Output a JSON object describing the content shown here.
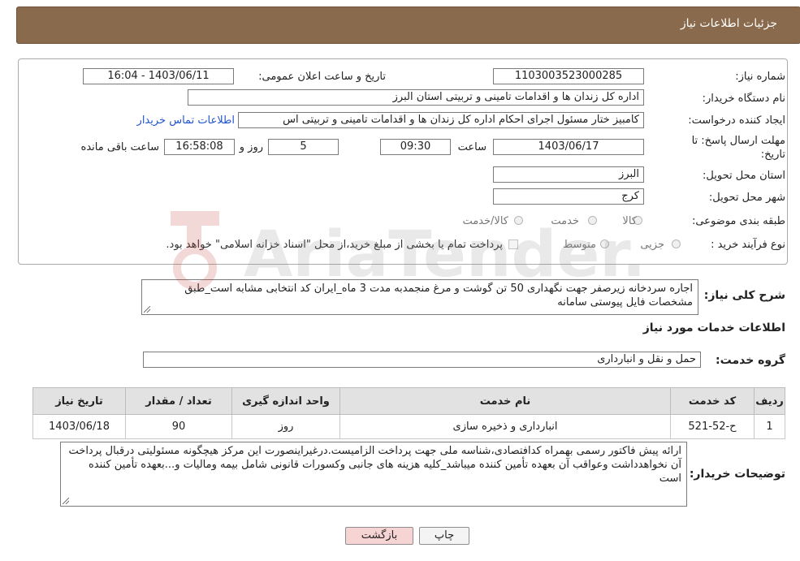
{
  "header": {
    "title": "جزئیات اطلاعات نیاز"
  },
  "form": {
    "need_number_label": "شماره نیاز:",
    "need_number": "1103003523000285",
    "announce_datetime_label": "تاریخ و ساعت اعلان عمومی:",
    "announce_datetime": "1403/06/11 - 16:04",
    "buyer_org_label": "نام دستگاه خریدار:",
    "buyer_org": "اداره کل زندان ها و اقدامات تامینی و تربیتی استان البرز",
    "requester_label": "ایجاد کننده درخواست:",
    "requester": "کامبیز ختار مسئول اجرای احکام اداره کل زندان ها و اقدامات تامینی و تربیتی اس",
    "contact_link": "اطلاعات تماس خریدار",
    "deadline_label_line1": "مهلت ارسال پاسخ: تا",
    "deadline_label_line2": "تاریخ:",
    "deadline_date": "1403/06/17",
    "time_label": "ساعت",
    "deadline_time": "09:30",
    "days_value": "5",
    "days_label": "روز و",
    "remaining_time": "16:58:08",
    "remaining_label": "ساعت باقی مانده",
    "province_label": "استان محل تحویل:",
    "province": "البرز",
    "city_label": "شهر محل تحویل:",
    "city": "کرج",
    "category_label": "طبقه بندی موضوعی:",
    "category_options": [
      "کالا",
      "خدمت",
      "کالا/خدمت"
    ],
    "purchase_type_label": "نوع فرآیند خرید :",
    "purchase_type_options": [
      "جزیی",
      "متوسط"
    ],
    "payment_note": "پرداخت تمام یا بخشی از مبلغ خرید،از محل \"اسناد خزانه اسلامی\" خواهد بود."
  },
  "description": {
    "label": "شرح کلی نیاز:",
    "text": "اجاره سردخانه زیرصفر جهت نگهداری 50 تن گوشت و مرغ منجمدبه مدت 3 ماه_ایران کد انتخابی مشابه است_طبق مشخصات فایل پیوستی سامانه"
  },
  "services": {
    "section_title": "اطلاعات خدمات مورد نیاز",
    "group_label": "گروه خدمت:",
    "group_value": "حمل و نقل و انبارداری",
    "columns": [
      "ردیف",
      "کد خدمت",
      "نام خدمت",
      "واحد اندازه گیری",
      "تعداد / مقدار",
      "تاریخ نیاز"
    ],
    "rows": [
      [
        "1",
        "ح-52-521",
        "انبارداری و ذخیره سازی",
        "روز",
        "90",
        "1403/06/18"
      ]
    ]
  },
  "buyer_notes": {
    "label": "توضیحات خریدار:",
    "text": "ارائه پیش فاکتور رسمی بهمراه کدافتصادی،شناسه ملی جهت پرداخت الزامیست.درغیراینصورت این مرکز هیچگونه مسئولیتی درقبال پرداخت آن نخواهدداشت وعواقب آن بعهده تأمین کننده میباشد_کلیه هزینه های جانبی وکسورات قانونی شامل بیمه ومالیات و...بعهده تأمین کننده است"
  },
  "buttons": {
    "print": "چاپ",
    "back": "بازگشت"
  },
  "watermark": {
    "text": "AriaTender.neT"
  },
  "colors": {
    "header_bg": "#8a6a4c",
    "link": "#2255cc",
    "back_button": "#f7d4d4"
  }
}
